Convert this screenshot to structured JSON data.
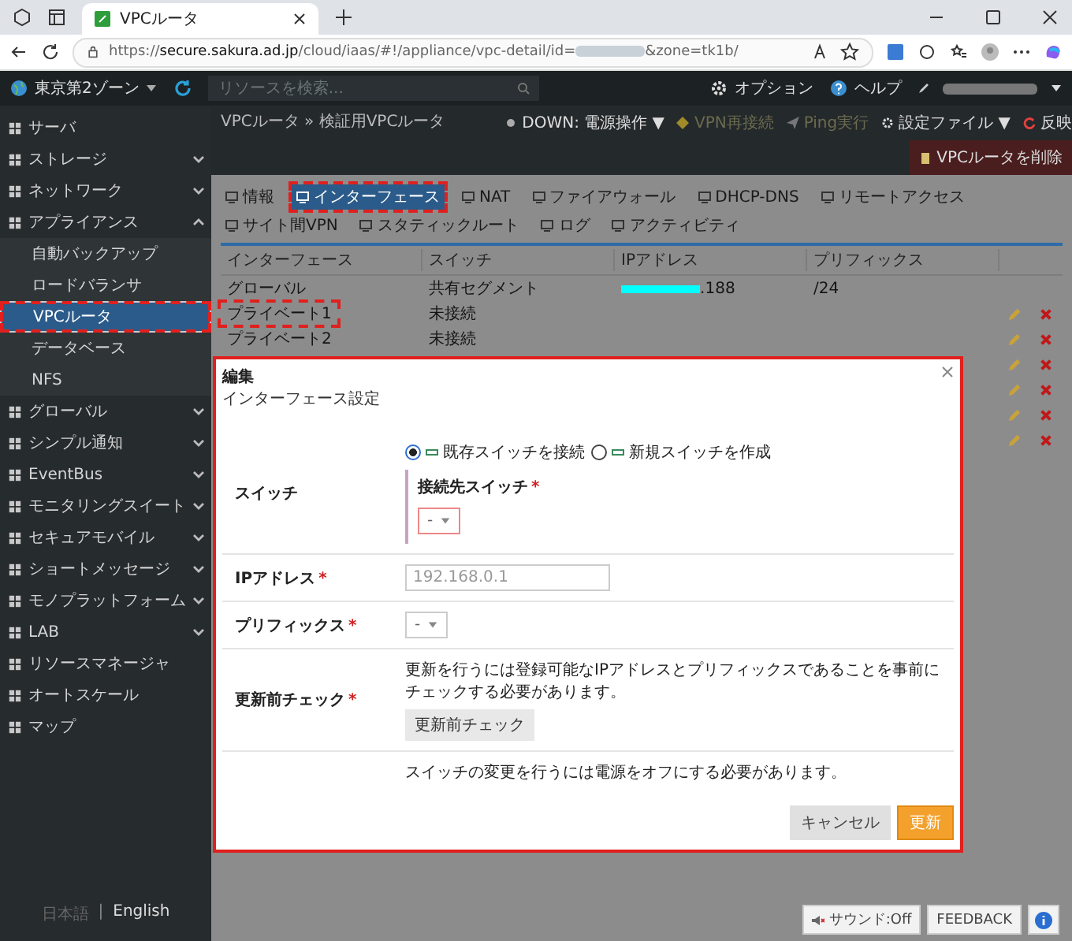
{
  "browser": {
    "tab_title": "VPCルータ",
    "url_scheme": "https://",
    "url_host": "secure.sakura.ad.jp",
    "url_path": "/cloud/iaas/#!/appliance/vpc-detail/id=",
    "url_suffix": "&zone=tk1b/"
  },
  "header": {
    "zone": "東京第2ゾーン",
    "search_placeholder": "リソースを検索...",
    "links": [
      "オプション",
      "ヘルプ"
    ]
  },
  "sidebar": {
    "items": [
      {
        "label": "サーバ",
        "kind": "item",
        "selected": false
      },
      {
        "label": "ストレージ",
        "kind": "group",
        "expanded": false,
        "selected": false
      },
      {
        "label": "ネットワーク",
        "kind": "group",
        "expanded": false,
        "selected": false
      },
      {
        "label": "アプライアンス",
        "kind": "group",
        "expanded": true,
        "selected": false
      },
      {
        "label": "自動バックアップ",
        "kind": "subitem",
        "selected": false
      },
      {
        "label": "ロードバランサ",
        "kind": "subitem",
        "selected": false
      },
      {
        "label": "VPCルータ",
        "kind": "subitem",
        "selected": true,
        "highlighted": true
      },
      {
        "label": "データベース",
        "kind": "subitem",
        "selected": false
      },
      {
        "label": "NFS",
        "kind": "subitem",
        "selected": false
      },
      {
        "label": "グローバル",
        "kind": "group",
        "expanded": false,
        "selected": false
      },
      {
        "label": "シンプル通知",
        "kind": "group",
        "expanded": false,
        "selected": false
      },
      {
        "label": "EventBus",
        "kind": "group",
        "expanded": false,
        "selected": false
      },
      {
        "label": "モニタリングスイート",
        "kind": "group",
        "expanded": false,
        "selected": false
      },
      {
        "label": "セキュアモバイル",
        "kind": "group",
        "expanded": false,
        "selected": false
      },
      {
        "label": "ショートメッセージ",
        "kind": "group",
        "expanded": false,
        "selected": false
      },
      {
        "label": "モノプラットフォーム",
        "kind": "group",
        "expanded": false,
        "selected": false
      },
      {
        "label": "LAB",
        "kind": "group",
        "expanded": false,
        "selected": false
      },
      {
        "label": "リソースマネージャ",
        "kind": "item",
        "selected": false
      },
      {
        "label": "オートスケール",
        "kind": "item",
        "selected": false
      },
      {
        "label": "マップ",
        "kind": "item",
        "selected": false
      }
    ],
    "languages": [
      {
        "label": "日本語",
        "selected": true
      },
      {
        "label": "English",
        "selected": false
      }
    ],
    "separator": "|"
  },
  "toolbar": {
    "breadcrumb": "VPCルータ » 検証用VPCルータ",
    "actions": [
      {
        "label": "DOWN: 電源操作 ▼",
        "kind": "status",
        "disabled": false
      },
      {
        "label": "VPN再接続",
        "kind": "vpn",
        "disabled": true
      },
      {
        "label": "Ping実行",
        "kind": "ping",
        "disabled": true
      },
      {
        "label": "設定ファイル ▼",
        "kind": "config",
        "disabled": false
      },
      {
        "label": "反映",
        "kind": "apply",
        "disabled": false
      },
      {
        "label": "VPCルータを削除",
        "kind": "danger",
        "disabled": false
      }
    ]
  },
  "tabs": [
    {
      "label": "情報",
      "selected": false
    },
    {
      "label": "インターフェース",
      "selected": true,
      "highlighted": true
    },
    {
      "label": "NAT",
      "selected": false
    },
    {
      "label": "ファイアウォール",
      "selected": false
    },
    {
      "label": "DHCP-DNS",
      "selected": false
    },
    {
      "label": "リモートアクセス",
      "selected": false
    },
    {
      "label": "サイト間VPN",
      "selected": false
    },
    {
      "label": "スタティックルート",
      "selected": false
    },
    {
      "label": "ログ",
      "selected": false
    },
    {
      "label": "アクティビティ",
      "selected": false
    }
  ],
  "table": {
    "columns": [
      "インターフェース",
      "スイッチ",
      "IPアドレス",
      "プリフィックス"
    ],
    "rows": [
      {
        "interface": "グローバル",
        "switch": "共有セグメント",
        "ip_suffix": ".188",
        "prefix": "/24",
        "editable": false
      },
      {
        "interface": "プライベート1",
        "switch": "未接続",
        "editable": true,
        "highlighted": true
      },
      {
        "interface": "プライベート2",
        "switch": "未接続",
        "editable": true
      },
      {
        "editable": true
      },
      {
        "editable": true
      },
      {
        "editable": true
      },
      {
        "editable": true
      }
    ]
  },
  "modal": {
    "title": "編集",
    "subtitle": "インターフェース設定",
    "switch": {
      "label": "スイッチ",
      "options": [
        {
          "label": "既存スイッチを接続",
          "selected": true
        },
        {
          "label": "新規スイッチを作成",
          "selected": false
        }
      ],
      "target_label": "接続先スイッチ",
      "mark": "*",
      "value": "-",
      "invalid": true
    },
    "ip": {
      "label": "IPアドレス",
      "mark": "*",
      "placeholder": "192.168.0.1"
    },
    "prefix": {
      "label": "プリフィックス",
      "mark": "*",
      "value": "-"
    },
    "check": {
      "label": "更新前チェック",
      "mark": "*",
      "note": "更新を行うには登録可能なIPアドレスとプリフィックスであることを事前にチェックする必要があります。",
      "button": "更新前チェック"
    },
    "notice": "スイッチの変更を行うには電源をオフにする必要があります。",
    "buttons": [
      {
        "label": "キャンセル",
        "kind": "secondary"
      },
      {
        "label": "更新",
        "kind": "primary"
      }
    ]
  },
  "footer": {
    "sound": "サウンド:Off",
    "feedback": "FEEDBACK"
  }
}
